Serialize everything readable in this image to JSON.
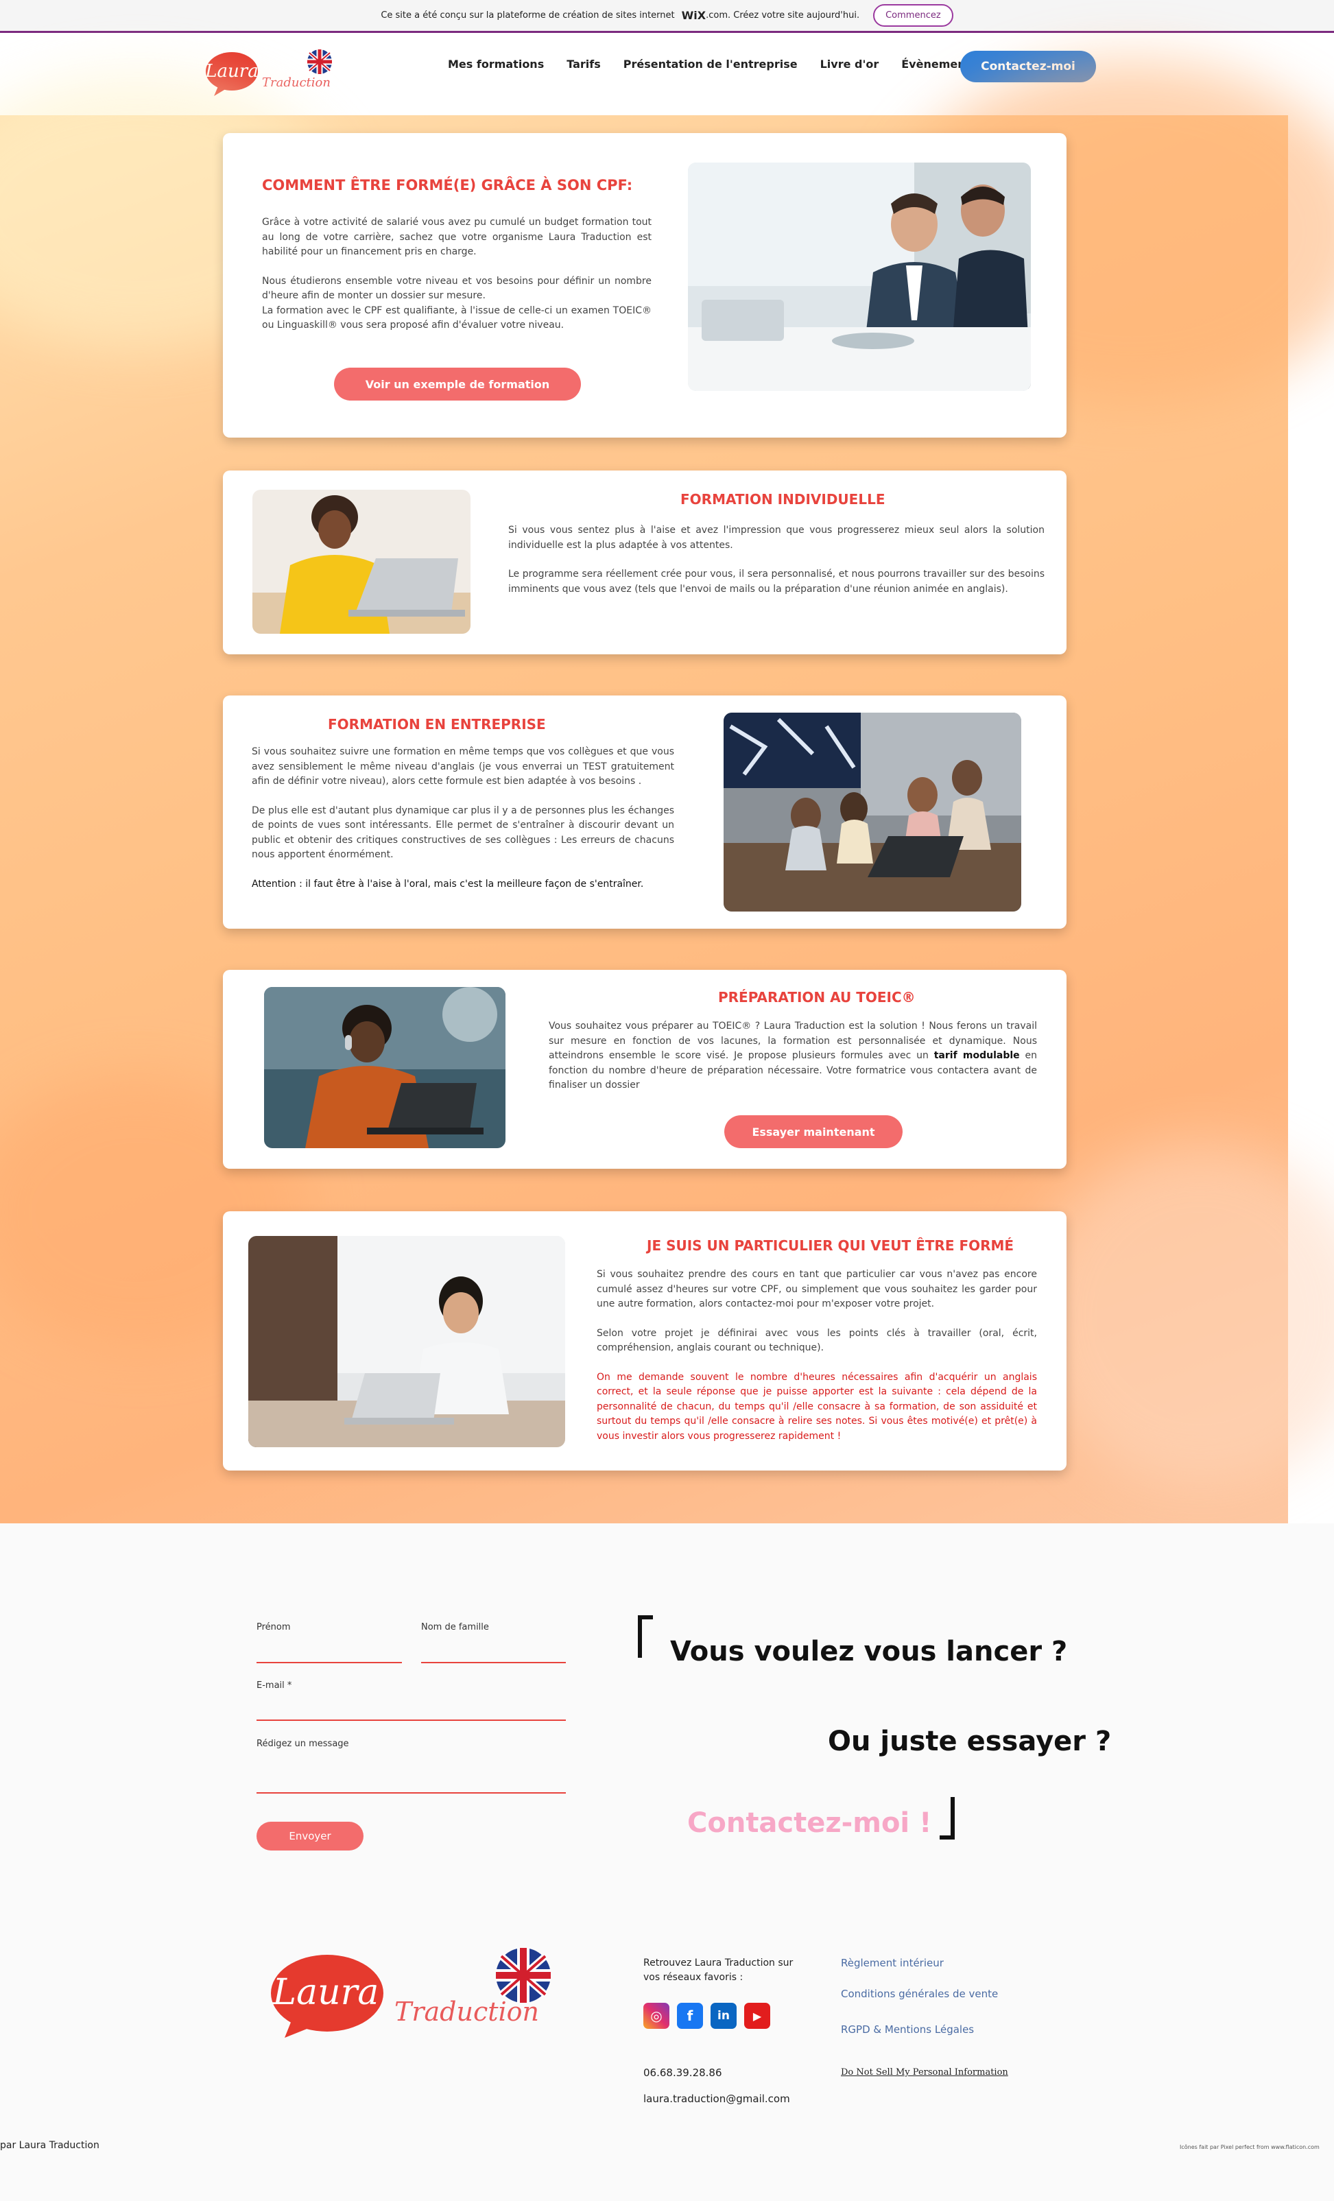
{
  "wix_banner": {
    "text": "Ce site a été conçu sur la plateforme de création de sites internet",
    "brand": "WiX",
    "brand_suffix": ".com. Créez votre site aujourd'hui.",
    "button": "Commencez"
  },
  "header": {
    "logo_word": "Laura",
    "logo_script": "Traduction",
    "nav": [
      "Mes formations",
      "Tarifs",
      "Présentation de l'entreprise",
      "Livre d'or",
      "Évènements"
    ],
    "cta": "Contactez-moi"
  },
  "cards": {
    "cpf": {
      "title": "COMMENT ÊTRE FORMÉ(E) GRÂCE À SON CPF:",
      "p1": "Grâce à votre activité de salarié vous avez pu cumulé un budget formation tout au long de votre carrière, sachez que votre organisme Laura Traduction est habilité pour un financement pris en charge.",
      "p2": "Nous étudierons ensemble votre niveau et vos besoins pour définir un nombre d'heure afin de monter un dossier sur mesure.",
      "p3": "La formation avec le CPF est qualifiante, à l'issue de celle-ci un examen TOEIC® ou Linguaskill® vous sera proposé afin d'évaluer votre niveau.",
      "button": "Voir un exemple de formation"
    },
    "individuelle": {
      "title": "FORMATION INDIVIDUELLE",
      "p1": "Si vous vous sentez plus à l'aise et avez l'impression que vous progresserez mieux seul alors la solution individuelle est la plus adaptée à vos attentes.",
      "p2": "Le programme sera réellement crée pour vous, il sera personnalisé, et nous pourrons travailler sur des besoins imminents que vous avez (tels que l'envoi de mails ou la préparation d'une réunion animée en anglais)."
    },
    "entreprise": {
      "title": "FORMATION EN ENTREPRISE",
      "p1": "Si vous souhaitez suivre une formation en même temps que vos collègues et que vous avez sensiblement le même niveau d'anglais (je vous enverrai un TEST gratuitement afin de définir votre niveau), alors cette formule est bien adaptée à vos besoins .",
      "p2": "De plus elle est d'autant plus dynamique car plus il y a de personnes plus les échanges de points de vues sont intéressants. Elle permet de s'entraîner à discourir devant un public et obtenir des critiques constructives de ses collègues : Les erreurs de chacuns nous apportent énormément.",
      "p3": "Attention : il faut être à l'aise à l'oral, mais c'est la meilleure façon de s'entraîner."
    },
    "toeic": {
      "title": "PRÉPARATION AU TOEIC®",
      "p1a": "Vous souhaitez vous préparer au TOEIC® ? Laura Traduction est la solution ! Nous ferons un travail sur mesure en fonction de vos lacunes, la formation est personnalisée et dynamique. Nous atteindrons ensemble le score visé. Je propose plusieurs formules avec un",
      "p1b": "tarif modulable",
      "p1c": "en fonction du nombre d'heure de préparation nécessaire. Votre formatrice vous contactera avant de finaliser un dossier",
      "button": "Essayer maintenant"
    },
    "particulier": {
      "title": "JE SUIS UN PARTICULIER QUI VEUT ÊTRE FORMÉ",
      "p1": "Si vous souhaitez prendre des cours en tant que particulier car vous n'avez pas encore cumulé assez d'heures sur votre CPF, ou simplement que vous souhaitez les garder pour une autre formation, alors contactez-moi pour m'exposer votre projet.",
      "p2": "Selon votre projet je définirai avec vous les points clés à travailler (oral, écrit, compréhension, anglais courant ou technique).",
      "p3": "On me demande souvent le nombre d'heures nécessaires afin d'acquérir un anglais correct, et la seule réponse que je puisse apporter est la suivante : cela dépend de la personnalité de chacun, du temps qu'il /elle consacre à sa formation, de son assiduité et surtout du temps qu'il /elle consacre à relire ses notes. Si vous êtes motivé(e) et prêt(e) à vous investir alors vous progresserez rapidement !"
    }
  },
  "form": {
    "first_name": "Prénom",
    "last_name": "Nom de famille",
    "email": "E-mail *",
    "message": "Rédigez un message",
    "submit": "Envoyer"
  },
  "pitch": {
    "line1": "Vous voulez vous lancer ?",
    "line2": "Ou juste essayer ?",
    "line3": "Contactez-moi !"
  },
  "footer": {
    "social_text": "Retrouvez Laura Traduction sur vos réseaux favoris :",
    "phone": "06.68.39.28.86",
    "email": "laura.traduction@gmail.com",
    "links": [
      "Règlement intérieur",
      "Conditions générales de vente",
      "RGPD & Mentions Légales"
    ],
    "do_not_sell": "Do Not Sell My Personal Information",
    "copyright": "par Laura Traduction",
    "credits": "Icônes fait par Pixel perfect from www.flaticon.com"
  },
  "colors": {
    "accent": "#e8433d",
    "button": "#f36c6c",
    "cta": "#2e7fd9",
    "pink": "#f7a7c6"
  }
}
